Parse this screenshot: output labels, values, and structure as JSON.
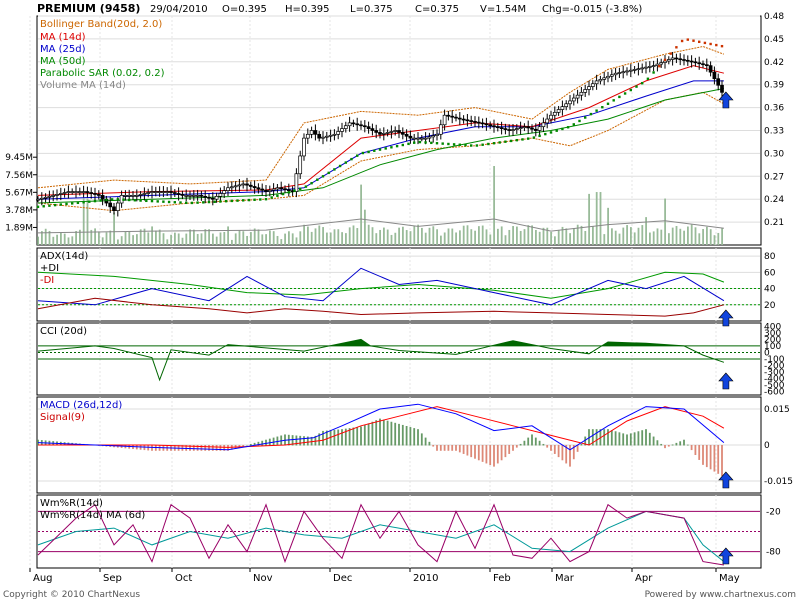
{
  "header": {
    "symbol": "PREMIUM (9458)",
    "date": "29/04/2010",
    "open": "O=0.395",
    "high": "H=0.395",
    "low": "L=0.375",
    "close": "C=0.375",
    "volume": "V=1.54M",
    "change": "Chg=-0.015 (-3.8%)"
  },
  "footer": {
    "copyright": "Copyright © 2010 ChartNexus",
    "powered": "Powered by www.chartnexus.com"
  },
  "colors": {
    "bollinger": "#cc6600",
    "ma14": "#dd0000",
    "ma25": "#0000cc",
    "ma50": "#008800",
    "sar": "#008800",
    "volume_ma": "#888888",
    "adx": "#009900",
    "plus_di": "#0000cc",
    "minus_di": "#990000",
    "cci": "#006600",
    "macd": "#0000ff",
    "signal": "#ff0000",
    "hist_pos": "#669966",
    "hist_neg": "#dd8877",
    "wmr": "#990066",
    "wmr_ma": "#009999",
    "volume_bar": "#99bb99",
    "arrow": "#1144dd"
  },
  "chart_data": [
    {
      "type": "candlestick",
      "panel": "price",
      "legend": [
        "Bollinger Band(20d, 2.0)",
        "MA (14d)",
        "MA (25d)",
        "MA (50d)",
        "Parabolic SAR (0.02, 0.2)",
        "Volume MA (14d)"
      ],
      "x_tick_labels": [
        "Aug",
        "Sep",
        "Oct",
        "Nov",
        "Dec",
        "2010",
        "Feb",
        "Mar",
        "Apr",
        "May"
      ],
      "y_tick_labels": [
        "0.48",
        "0.45",
        "0.42",
        "0.39",
        "0.36",
        "0.33",
        "0.30",
        "0.27",
        "0.24",
        "0.21"
      ],
      "ylim": [
        0.18,
        0.48
      ],
      "close_path": [
        [
          0,
          0.24
        ],
        [
          8,
          0.245
        ],
        [
          16,
          0.25
        ],
        [
          24,
          0.25
        ],
        [
          32,
          0.245
        ],
        [
          40,
          0.225
        ],
        [
          44,
          0.245
        ],
        [
          52,
          0.245
        ],
        [
          60,
          0.25
        ],
        [
          68,
          0.25
        ],
        [
          76,
          0.245
        ],
        [
          84,
          0.245
        ],
        [
          92,
          0.24
        ],
        [
          100,
          0.255
        ],
        [
          108,
          0.26
        ],
        [
          114,
          0.255
        ],
        [
          120,
          0.25
        ],
        [
          126,
          0.255
        ],
        [
          134,
          0.25
        ],
        [
          140,
          0.32
        ],
        [
          144,
          0.33
        ],
        [
          148,
          0.32
        ],
        [
          156,
          0.325
        ],
        [
          164,
          0.34
        ],
        [
          172,
          0.335
        ],
        [
          180,
          0.325
        ],
        [
          188,
          0.33
        ],
        [
          196,
          0.32
        ],
        [
          204,
          0.32
        ],
        [
          210,
          0.325
        ],
        [
          214,
          0.35
        ],
        [
          222,
          0.345
        ],
        [
          232,
          0.34
        ],
        [
          240,
          0.335
        ],
        [
          248,
          0.33
        ],
        [
          256,
          0.335
        ],
        [
          262,
          0.33
        ],
        [
          270,
          0.35
        ],
        [
          278,
          0.365
        ],
        [
          286,
          0.38
        ],
        [
          294,
          0.395
        ],
        [
          304,
          0.405
        ],
        [
          314,
          0.41
        ],
        [
          324,
          0.415
        ],
        [
          334,
          0.425
        ],
        [
          344,
          0.42
        ],
        [
          352,
          0.415
        ],
        [
          359,
          0.385
        ],
        [
          361,
          0.375
        ]
      ],
      "bollinger_upper_path": [
        [
          0,
          0.255
        ],
        [
          40,
          0.265
        ],
        [
          80,
          0.26
        ],
        [
          120,
          0.265
        ],
        [
          140,
          0.34
        ],
        [
          170,
          0.355
        ],
        [
          200,
          0.35
        ],
        [
          230,
          0.36
        ],
        [
          260,
          0.345
        ],
        [
          280,
          0.38
        ],
        [
          300,
          0.41
        ],
        [
          330,
          0.43
        ],
        [
          350,
          0.44
        ],
        [
          361,
          0.43
        ]
      ],
      "bollinger_lower_path": [
        [
          0,
          0.235
        ],
        [
          40,
          0.225
        ],
        [
          80,
          0.235
        ],
        [
          120,
          0.24
        ],
        [
          140,
          0.245
        ],
        [
          170,
          0.29
        ],
        [
          200,
          0.305
        ],
        [
          230,
          0.31
        ],
        [
          260,
          0.32
        ],
        [
          280,
          0.31
        ],
        [
          300,
          0.33
        ],
        [
          330,
          0.37
        ],
        [
          350,
          0.38
        ],
        [
          361,
          0.365
        ]
      ],
      "ma14_path": [
        [
          0,
          0.245
        ],
        [
          60,
          0.25
        ],
        [
          120,
          0.252
        ],
        [
          140,
          0.26
        ],
        [
          170,
          0.32
        ],
        [
          200,
          0.33
        ],
        [
          230,
          0.34
        ],
        [
          260,
          0.335
        ],
        [
          290,
          0.36
        ],
        [
          320,
          0.395
        ],
        [
          345,
          0.415
        ],
        [
          361,
          0.405
        ]
      ],
      "ma25_path": [
        [
          0,
          0.24
        ],
        [
          60,
          0.245
        ],
        [
          120,
          0.25
        ],
        [
          140,
          0.255
        ],
        [
          170,
          0.3
        ],
        [
          200,
          0.32
        ],
        [
          230,
          0.335
        ],
        [
          260,
          0.335
        ],
        [
          290,
          0.35
        ],
        [
          320,
          0.375
        ],
        [
          345,
          0.395
        ],
        [
          361,
          0.395
        ]
      ],
      "ma50_path": [
        [
          0,
          0.235
        ],
        [
          60,
          0.24
        ],
        [
          120,
          0.245
        ],
        [
          150,
          0.255
        ],
        [
          180,
          0.285
        ],
        [
          210,
          0.305
        ],
        [
          240,
          0.32
        ],
        [
          270,
          0.33
        ],
        [
          300,
          0.345
        ],
        [
          330,
          0.37
        ],
        [
          361,
          0.385
        ]
      ],
      "sar_path": [
        [
          0,
          0.23
        ],
        [
          40,
          0.24
        ],
        [
          80,
          0.235
        ],
        [
          120,
          0.24
        ],
        [
          140,
          0.255
        ],
        [
          170,
          0.3
        ],
        [
          200,
          0.315
        ],
        [
          230,
          0.31
        ],
        [
          260,
          0.32
        ],
        [
          280,
          0.335
        ],
        [
          300,
          0.365
        ],
        [
          320,
          0.395
        ],
        [
          340,
          0.45
        ],
        [
          361,
          0.44
        ]
      ],
      "arrow_x": 361
    },
    {
      "type": "bar",
      "panel": "volume",
      "y_tick_labels": [
        "9.45M",
        "7.56M",
        "5.67M",
        "3.78M",
        "1.89M"
      ],
      "ylim": [
        0,
        11.3
      ],
      "spikes": [
        [
          25,
          5.0
        ],
        [
          40,
          3.5
        ],
        [
          60,
          2.0
        ],
        [
          100,
          2.0
        ],
        [
          170,
          6.5
        ],
        [
          172,
          3.8
        ],
        [
          240,
          8.5
        ],
        [
          244,
          2.0
        ],
        [
          290,
          5.5
        ],
        [
          295,
          5.7
        ],
        [
          300,
          4.0
        ],
        [
          320,
          3.0
        ],
        [
          330,
          5.0
        ],
        [
          340,
          1.54
        ]
      ],
      "volume_ma_path": [
        [
          0,
          1.3
        ],
        [
          60,
          1.5
        ],
        [
          120,
          1.6
        ],
        [
          170,
          2.8
        ],
        [
          200,
          2.0
        ],
        [
          240,
          2.8
        ],
        [
          270,
          1.5
        ],
        [
          300,
          2.2
        ],
        [
          330,
          2.6
        ],
        [
          361,
          1.8
        ]
      ]
    },
    {
      "type": "line",
      "panel": "adx",
      "legend": [
        "ADX(14d)",
        "+DI",
        "-DI"
      ],
      "y_tick_labels": [
        "80",
        "60",
        "40",
        "20"
      ],
      "ylim": [
        0,
        90
      ],
      "adx_path": [
        [
          0,
          60
        ],
        [
          40,
          55
        ],
        [
          80,
          45
        ],
        [
          110,
          35
        ],
        [
          140,
          32
        ],
        [
          170,
          40
        ],
        [
          200,
          45
        ],
        [
          240,
          38
        ],
        [
          270,
          28
        ],
        [
          300,
          40
        ],
        [
          330,
          60
        ],
        [
          350,
          58
        ],
        [
          361,
          48
        ]
      ],
      "plus_di_path": [
        [
          0,
          25
        ],
        [
          30,
          20
        ],
        [
          60,
          40
        ],
        [
          90,
          25
        ],
        [
          110,
          55
        ],
        [
          130,
          30
        ],
        [
          150,
          25
        ],
        [
          170,
          65
        ],
        [
          190,
          45
        ],
        [
          210,
          50
        ],
        [
          240,
          35
        ],
        [
          270,
          20
        ],
        [
          300,
          50
        ],
        [
          320,
          40
        ],
        [
          340,
          55
        ],
        [
          361,
          25
        ]
      ],
      "minus_di_path": [
        [
          0,
          15
        ],
        [
          30,
          28
        ],
        [
          60,
          20
        ],
        [
          90,
          15
        ],
        [
          110,
          10
        ],
        [
          130,
          15
        ],
        [
          150,
          12
        ],
        [
          170,
          8
        ],
        [
          200,
          10
        ],
        [
          240,
          12
        ],
        [
          270,
          10
        ],
        [
          300,
          8
        ],
        [
          330,
          6
        ],
        [
          345,
          10
        ],
        [
          361,
          20
        ]
      ]
    },
    {
      "type": "line",
      "panel": "cci",
      "legend": [
        "CCI (20d)"
      ],
      "y_tick_labels": [
        "400",
        "300",
        "200",
        "100",
        "0",
        "-100",
        "-200",
        "-300",
        "-400",
        "-500",
        "-600"
      ],
      "ylim": [
        -650,
        450
      ],
      "cci_path": [
        [
          0,
          20
        ],
        [
          30,
          100
        ],
        [
          40,
          60
        ],
        [
          60,
          -80
        ],
        [
          64,
          -420
        ],
        [
          70,
          40
        ],
        [
          90,
          -40
        ],
        [
          100,
          120
        ],
        [
          140,
          20
        ],
        [
          170,
          200
        ],
        [
          175,
          100
        ],
        [
          190,
          30
        ],
        [
          220,
          -30
        ],
        [
          250,
          180
        ],
        [
          270,
          60
        ],
        [
          290,
          -20
        ],
        [
          300,
          160
        ],
        [
          320,
          140
        ],
        [
          340,
          100
        ],
        [
          350,
          -40
        ],
        [
          361,
          -150
        ]
      ]
    },
    {
      "type": "line",
      "panel": "macd",
      "legend": [
        "MACD (26d,12d)",
        "Signal(9)"
      ],
      "y_tick_labels": [
        "0.015",
        "0",
        "-0.015"
      ],
      "ylim": [
        -0.02,
        0.02
      ],
      "macd_path": [
        [
          0,
          0.001
        ],
        [
          60,
          -0.001
        ],
        [
          100,
          -0.002
        ],
        [
          130,
          0.002
        ],
        [
          145,
          0.003
        ],
        [
          160,
          0.008
        ],
        [
          180,
          0.015
        ],
        [
          200,
          0.017
        ],
        [
          220,
          0.013
        ],
        [
          240,
          0.006
        ],
        [
          260,
          0.008
        ],
        [
          280,
          -0.002
        ],
        [
          300,
          0.008
        ],
        [
          320,
          0.016
        ],
        [
          340,
          0.015
        ],
        [
          361,
          0.001
        ]
      ],
      "signal_path": [
        [
          0,
          0.0
        ],
        [
          60,
          0.0
        ],
        [
          100,
          -0.001
        ],
        [
          130,
          0.0
        ],
        [
          150,
          0.002
        ],
        [
          170,
          0.008
        ],
        [
          190,
          0.012
        ],
        [
          210,
          0.016
        ],
        [
          230,
          0.012
        ],
        [
          250,
          0.008
        ],
        [
          270,
          0.004
        ],
        [
          290,
          0.0
        ],
        [
          310,
          0.01
        ],
        [
          330,
          0.016
        ],
        [
          350,
          0.012
        ],
        [
          361,
          0.007
        ]
      ]
    },
    {
      "type": "line",
      "panel": "williams",
      "legend": [
        "Wm%R(14d)",
        "Wm%R(14d) MA (6d)"
      ],
      "y_tick_labels": [
        "-20",
        "-80"
      ],
      "ylim": [
        -100,
        0
      ],
      "wmr_path": [
        [
          0,
          -85
        ],
        [
          20,
          -30
        ],
        [
          30,
          -10
        ],
        [
          40,
          -70
        ],
        [
          50,
          -40
        ],
        [
          60,
          -95
        ],
        [
          70,
          -10
        ],
        [
          80,
          -30
        ],
        [
          90,
          -90
        ],
        [
          100,
          -40
        ],
        [
          110,
          -80
        ],
        [
          120,
          -10
        ],
        [
          130,
          -95
        ],
        [
          140,
          -20
        ],
        [
          150,
          -60
        ],
        [
          160,
          -90
        ],
        [
          170,
          -10
        ],
        [
          180,
          -60
        ],
        [
          190,
          -20
        ],
        [
          200,
          -70
        ],
        [
          210,
          -95
        ],
        [
          220,
          -20
        ],
        [
          230,
          -75
        ],
        [
          240,
          -10
        ],
        [
          250,
          -85
        ],
        [
          260,
          -90
        ],
        [
          270,
          -60
        ],
        [
          280,
          -95
        ],
        [
          290,
          -80
        ],
        [
          300,
          -10
        ],
        [
          310,
          -30
        ],
        [
          320,
          -20
        ],
        [
          330,
          -25
        ],
        [
          340,
          -30
        ],
        [
          350,
          -95
        ],
        [
          361,
          -100
        ]
      ],
      "wmr_ma_path": [
        [
          0,
          -70
        ],
        [
          20,
          -50
        ],
        [
          40,
          -45
        ],
        [
          60,
          -70
        ],
        [
          80,
          -50
        ],
        [
          100,
          -60
        ],
        [
          120,
          -45
        ],
        [
          140,
          -55
        ],
        [
          160,
          -60
        ],
        [
          180,
          -40
        ],
        [
          200,
          -50
        ],
        [
          220,
          -60
        ],
        [
          240,
          -40
        ],
        [
          260,
          -75
        ],
        [
          280,
          -80
        ],
        [
          300,
          -45
        ],
        [
          320,
          -20
        ],
        [
          340,
          -30
        ],
        [
          350,
          -70
        ],
        [
          361,
          -95
        ]
      ]
    }
  ]
}
